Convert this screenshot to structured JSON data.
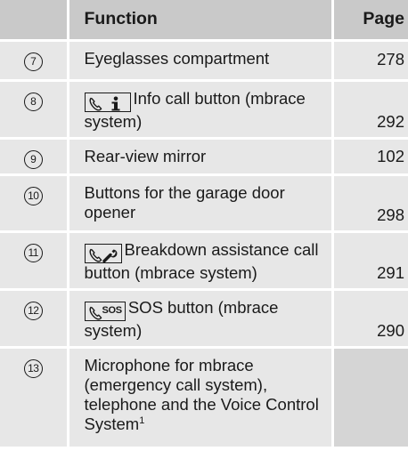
{
  "table": {
    "header": {
      "number": "",
      "function": "Function",
      "page": "Page"
    },
    "rows": [
      {
        "number": "7",
        "function": "Eyeglasses compartment",
        "page": "278",
        "icon": null
      },
      {
        "number": "8",
        "function": "Info call button (mbrace system)",
        "page": "292",
        "icon": "phone-info-icon"
      },
      {
        "number": "9",
        "function": "Rear-view mirror",
        "page": "102",
        "icon": null
      },
      {
        "number": "10",
        "function": "Buttons for the garage door opener",
        "page": "298",
        "icon": null
      },
      {
        "number": "11",
        "function": "Breakdown assistance call button (mbrace system)",
        "page": "291",
        "icon": "phone-wrench-icon"
      },
      {
        "number": "12",
        "function": "SOS button (mbrace system)",
        "page": "290",
        "icon": "phone-sos-icon",
        "icon_text": "SOS"
      },
      {
        "number": "13",
        "function": "Microphone for mbrace (emergency call system), telephone and the Voice Control System",
        "footnote": "1",
        "page": "",
        "icon": null
      }
    ]
  },
  "colors": {
    "header_bg": "#c9c9c9",
    "row_bg": "#e7e7e7",
    "empty_page_cell_bg": "#d5d5d5",
    "text": "#1a1a1a"
  }
}
